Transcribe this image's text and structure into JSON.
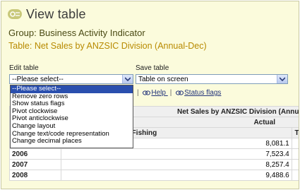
{
  "page": {
    "title": "View table",
    "group_line": "Group: Business Activity Indicator",
    "table_line": "Table: Net Sales by ANZSIC Division (Annual-Dec)"
  },
  "edit_table": {
    "label": "Edit table",
    "selected": "--Please select--",
    "options": [
      "--Please select--",
      "Remove zero rows",
      "Show status flags",
      "Pivot clockwise",
      "Pivot anticlockwise",
      "Change layout",
      "Change text/code representation",
      "Change decimal places"
    ]
  },
  "save_table": {
    "label": "Save table",
    "selected": "Table on screen"
  },
  "links": {
    "help": "Help",
    "status_flags": "Status flags"
  },
  "table": {
    "header_title": "Net Sales by ANZSIC Division (Annua",
    "actual_label": "Actual",
    "column_header": "ulture, Forestry and Fishing",
    "next_column_fragment": "To",
    "rows": [
      {
        "year": "",
        "value": "8,081.1"
      },
      {
        "year": "2006",
        "value": "7,523.4"
      },
      {
        "year": "2007",
        "value": "8,257.4"
      },
      {
        "year": "2008",
        "value": "9,488.6"
      }
    ]
  },
  "colors": {
    "background": "#fbfbdc",
    "table_title": "#b88a00",
    "selected_option": "#2a4fae"
  },
  "icons": {
    "logo": "view-table-icon",
    "link": "chain-link-icon",
    "select": "chevron-down-icon"
  }
}
